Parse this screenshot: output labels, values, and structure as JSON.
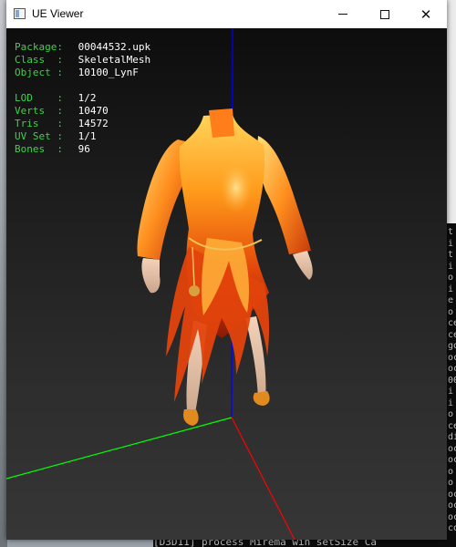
{
  "window": {
    "title": "UE Viewer",
    "controls": {
      "minimize": "—",
      "maximize": "□",
      "close": "✕"
    }
  },
  "info": {
    "package": {
      "label": "Package:",
      "value": "00044532.upk"
    },
    "class": {
      "label": "Class  :",
      "value": "SkeletalMesh"
    },
    "object": {
      "label": "Object :",
      "value": "10100_LynF"
    },
    "lod": {
      "label": "LOD    :",
      "value": "1/2"
    },
    "verts": {
      "label": "Verts  :",
      "value": "10470"
    },
    "tris": {
      "label": "Tris   :",
      "value": "14572"
    },
    "uvset": {
      "label": "UV Set :",
      "value": "1/1"
    },
    "bones": {
      "label": "Bones  :",
      "value": "96"
    }
  },
  "axes": {
    "x_color": "#ff0000",
    "y_color": "#00ff00",
    "z_color": "#0000ff"
  },
  "background_console": {
    "bottom_line": "[D3D11] process  Mirema win setSize  Ca",
    "right_glyphs": [
      "t",
      "i",
      "t",
      "i",
      "o",
      "i",
      "e",
      "o",
      "ce",
      "ce",
      "go",
      "oc",
      "oc",
      "00",
      "i",
      "i",
      "o",
      "ce",
      "di",
      "oc",
      "oc",
      "o",
      "o",
      "oc",
      "oc",
      "oc",
      "co"
    ]
  },
  "colors": {
    "info_key": "#3cd24a",
    "info_value": "#ffffff",
    "viewport_top": "#0d0d0d",
    "viewport_bottom": "#363636"
  }
}
